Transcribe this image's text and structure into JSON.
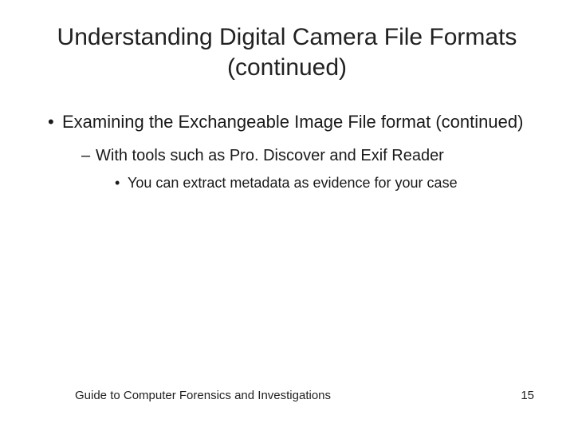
{
  "title": "Understanding Digital Camera File Formats (continued)",
  "bullets": {
    "l1": "Examining the Exchangeable Image File format (continued)",
    "l2": "With tools such as Pro. Discover and Exif Reader",
    "l3": "You can extract metadata as evidence for your case"
  },
  "footer": "Guide to Computer Forensics and Investigations",
  "page_number": "15"
}
